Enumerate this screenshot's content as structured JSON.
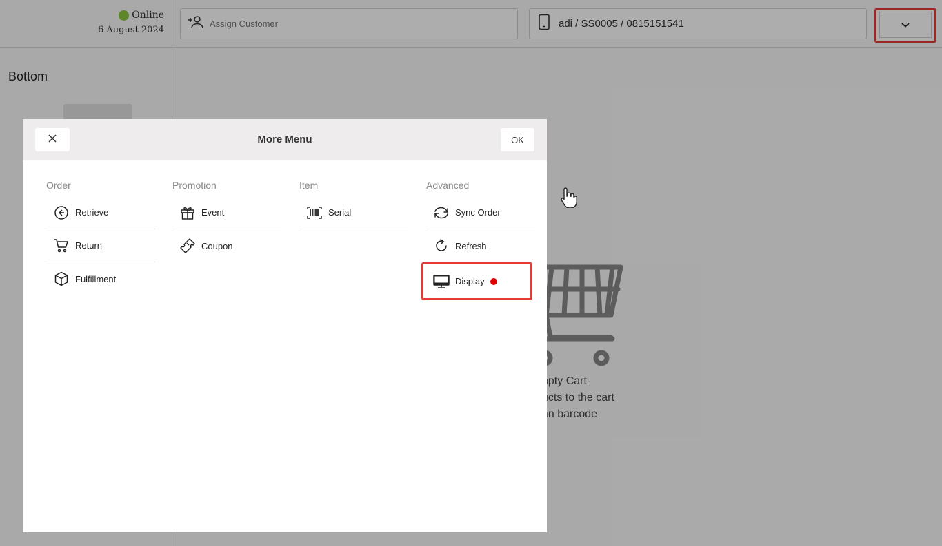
{
  "header": {
    "status_label": "Online",
    "status_color": "#8cc63f",
    "date": "6 August 2024",
    "customer_placeholder": "Assign Customer",
    "device_info": "adi / SS0005 / 0815151541"
  },
  "left_panel": {
    "section_title": "Bottom"
  },
  "empty_cart": {
    "title": "npty Cart",
    "line1": "ucts to the cart",
    "line2": "an barcode"
  },
  "modal": {
    "title": "More Menu",
    "ok_label": "OK",
    "columns": [
      {
        "title": "Order",
        "items": [
          {
            "label": "Retrieve",
            "icon": "arrow-left-circle-icon"
          },
          {
            "label": "Return",
            "icon": "cart-icon"
          },
          {
            "label": "Fulfillment",
            "icon": "box-icon"
          }
        ]
      },
      {
        "title": "Promotion",
        "items": [
          {
            "label": "Event",
            "icon": "gift-icon"
          },
          {
            "label": "Coupon",
            "icon": "ticket-icon"
          }
        ]
      },
      {
        "title": "Item",
        "items": [
          {
            "label": "Serial",
            "icon": "barcode-icon"
          }
        ]
      },
      {
        "title": "Advanced",
        "items": [
          {
            "label": "Sync Order",
            "icon": "sync-icon"
          },
          {
            "label": "Refresh",
            "icon": "refresh-icon"
          },
          {
            "label": "Display",
            "icon": "monitor-icon",
            "indicator_color": "#e00000"
          }
        ]
      }
    ]
  },
  "colors": {
    "highlight": "#e53935",
    "overlay": "rgba(0,0,0,0.32)"
  }
}
